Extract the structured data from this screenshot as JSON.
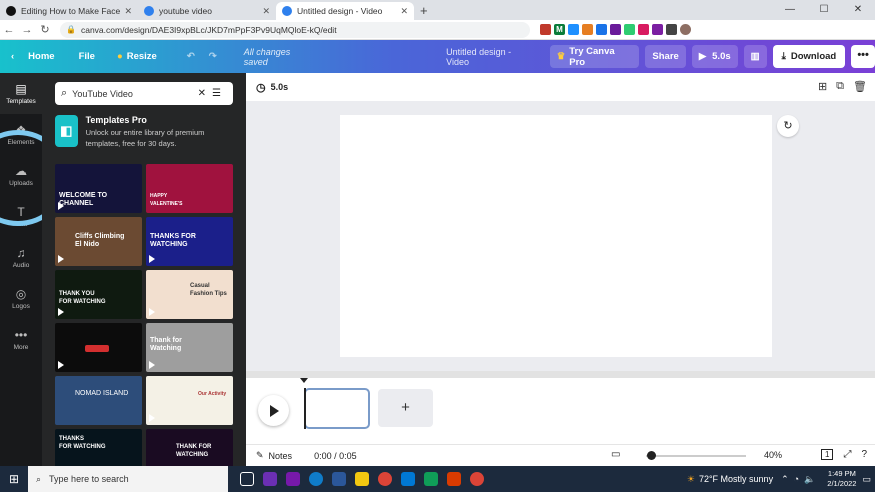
{
  "browser": {
    "tabs": [
      {
        "title": "Editing How to Make Faceless Yo",
        "color": "#111111"
      },
      {
        "title": "youtube video",
        "color": "#2f80ed"
      },
      {
        "title": "Untitled design - Video",
        "color": "#2f80ed"
      }
    ],
    "new_tab": "+",
    "url": "canva.com/design/DAE3I9xpBLc/JKD7mPpF3Pv9UqMQloE-kQ/edit"
  },
  "header": {
    "home": "Home",
    "file": "File",
    "resize": "Resize",
    "saved_status": "All changes saved",
    "doc_title": "Untitled design - Video",
    "try_pro": "Try Canva Pro",
    "share": "Share",
    "play_duration": "5.0s",
    "download": "Download",
    "more": "•••"
  },
  "rail": [
    {
      "label": "Templates",
      "icon": "templates-icon",
      "glyph": "▤"
    },
    {
      "label": "Elements",
      "icon": "elements-icon",
      "glyph": "❖"
    },
    {
      "label": "Uploads",
      "icon": "uploads-icon",
      "glyph": "☁"
    },
    {
      "label": "Text",
      "icon": "text-icon",
      "glyph": "T"
    },
    {
      "label": "Audio",
      "icon": "audio-icon",
      "glyph": "♫"
    },
    {
      "label": "Logos",
      "icon": "logos-icon",
      "glyph": "◎"
    },
    {
      "label": "More",
      "icon": "more-icon",
      "glyph": "•••"
    }
  ],
  "panel": {
    "search_value": "YouTube Video",
    "promo_title": "Templates Pro",
    "promo_desc": "Unlock our entire library of premium templates, free for 30 days."
  },
  "thumbnails": [
    {
      "caption": "WELCOME TO\nCHANNEL",
      "bg": "#14143a"
    },
    {
      "caption": "HAPPY\nVALENTINE'S",
      "bg": "#a0123e"
    },
    {
      "caption": "Cliffs Climbing\nEl Nido",
      "bg": "#6b4a32"
    },
    {
      "caption": "THANKS FOR\nWATCHING",
      "bg": "#1b1f8a"
    },
    {
      "caption": "THANK YOU\nFOR WATCHING",
      "bg": "#0f1a10"
    },
    {
      "caption": "Casual\nFashion Tips",
      "bg": "#f2dfcf"
    },
    {
      "caption": "",
      "bg": "#0c0c0c"
    },
    {
      "caption": "Thank for\nWatching",
      "bg": "#9e9e9e"
    },
    {
      "caption": "NOMAD ISLAND",
      "bg": "#2d4d7a"
    },
    {
      "caption": "Our Activity",
      "bg": "#f4f1e6"
    },
    {
      "caption": "THANKS\nFOR WATCHING",
      "bg": "#06141c"
    },
    {
      "caption": "THANK FOR\nWATCHING",
      "bg": "#1a0b22"
    }
  ],
  "canvas": {
    "duration": "5.0s"
  },
  "footer": {
    "notes": "Notes",
    "time": "0:00 / 0:05",
    "zoom": "40%",
    "page_num": "1"
  },
  "taskbar": {
    "search_placeholder": "Type here to search",
    "weather": "72°F  Mostly sunny",
    "time": "1:49 PM",
    "date": "2/1/2022"
  }
}
